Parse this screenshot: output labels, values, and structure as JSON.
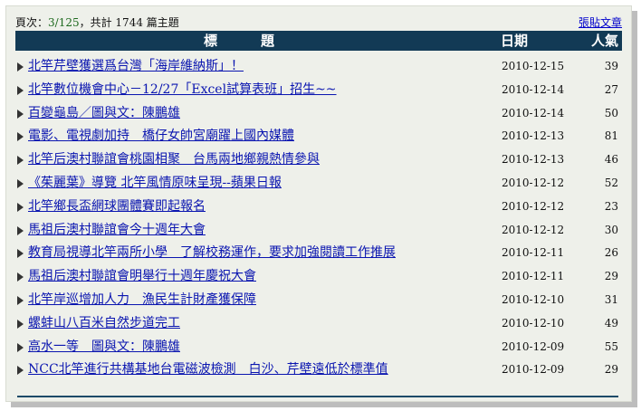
{
  "topbar": {
    "page_label": "頁次：",
    "page_value": "3/125",
    "total_text": "，共計 1744 篇主題",
    "post_link": "張貼文章"
  },
  "header": {
    "title_col": "標題",
    "date_col": "日期",
    "views_col": "人氣"
  },
  "rows": [
    {
      "title": "北竿芹壁獲選爲台灣「海岸維納斯」！",
      "date": "2010-12-15",
      "views": "39"
    },
    {
      "title": "北竿數位機會中心－12/27「Excel試算表班」招生~~",
      "date": "2010-12-14",
      "views": "27"
    },
    {
      "title": "百變龜島／圖與文：陳鵬雄",
      "date": "2010-12-14",
      "views": "50"
    },
    {
      "title": "電影、電視劇加持　橋仔女帥宮廟躍上國內媒體",
      "date": "2010-12-13",
      "views": "81"
    },
    {
      "title": "北竿后澳村聯誼會桃園相聚　台馬兩地鄉親熱情參與",
      "date": "2010-12-13",
      "views": "46"
    },
    {
      "title": "《茱麗葉》導覽 北竿風情原味呈現--蘋果日報",
      "date": "2010-12-12",
      "views": "52"
    },
    {
      "title": "北竿鄉長盃網球團體賽即起報名",
      "date": "2010-12-12",
      "views": "23"
    },
    {
      "title": "馬祖后澳村聯誼會今十週年大會",
      "date": "2010-12-12",
      "views": "30"
    },
    {
      "title": "教育局視導北竿兩所小學　了解校務運作，要求加強閱讀工作推展",
      "date": "2010-12-11",
      "views": "26"
    },
    {
      "title": "馬祖后澳村聯誼會明舉行十週年慶祝大會",
      "date": "2010-12-11",
      "views": "29"
    },
    {
      "title": "北竿岸巡增加人力　漁民生計財產獲保障",
      "date": "2010-12-10",
      "views": "31"
    },
    {
      "title": "螺蚌山八百米自然步道完工",
      "date": "2010-12-10",
      "views": "49"
    },
    {
      "title": "高水一等　圖與文：陳鵬雄",
      "date": "2010-12-09",
      "views": "55"
    },
    {
      "title": "NCC北竿進行共構基地台電磁波檢測　白沙、芹壁遠低於標準值",
      "date": "2010-12-09",
      "views": "29"
    }
  ]
}
